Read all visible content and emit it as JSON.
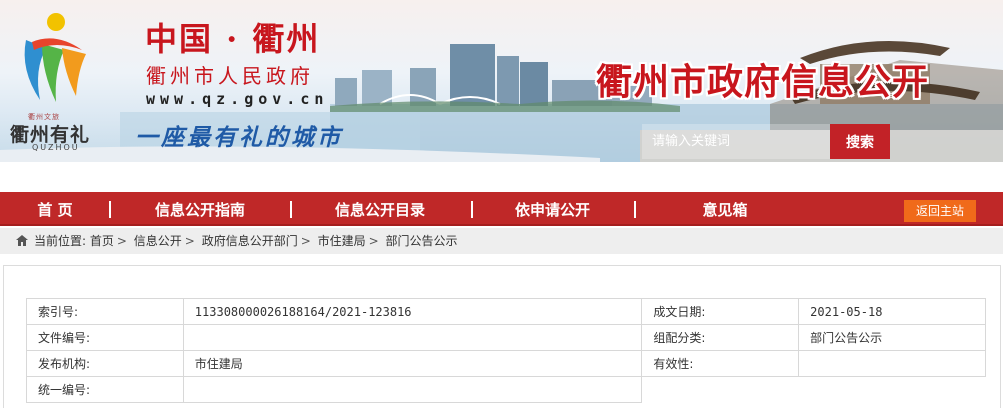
{
  "banner": {
    "logo_small": "衢州文旅",
    "logo_text": "衢州有礼",
    "logo_en": "QUZHOU",
    "site_title": "中国 · 衢州",
    "site_subtitle": "衢州市人民政府",
    "site_url": "www.qz.gov.cn",
    "slogan": "一座最有礼的城市",
    "big_title": "衢州市政府信息公开",
    "search_placeholder": "请输入关键词",
    "search_button": "搜索"
  },
  "nav": {
    "items": [
      {
        "label": "首 页"
      },
      {
        "label": "信息公开指南"
      },
      {
        "label": "信息公开目录"
      },
      {
        "label": "依申请公开"
      },
      {
        "label": "意见箱"
      }
    ],
    "home_button": "返回主站",
    "color": "#bf2828",
    "home_color": "#f06a1a"
  },
  "breadcrumb": {
    "prefix": "当前位置:",
    "items": [
      "首页",
      "信息公开",
      "政府信息公开部门",
      "市住建局",
      "部门公告公示"
    ],
    "separator": ">"
  },
  "meta": {
    "index_label": "索引号:",
    "index_value": "113308000026188164/2021-123816",
    "date_label": "成文日期:",
    "date_value": "2021-05-18",
    "docno_label": "文件编号:",
    "docno_value": "",
    "category_label": "组配分类:",
    "category_value": "部门公告公示",
    "issuer_label": "发布机构:",
    "issuer_value": "市住建局",
    "validity_label": "有效性:",
    "validity_value": "",
    "unified_label": "统一编号:",
    "unified_value": ""
  }
}
